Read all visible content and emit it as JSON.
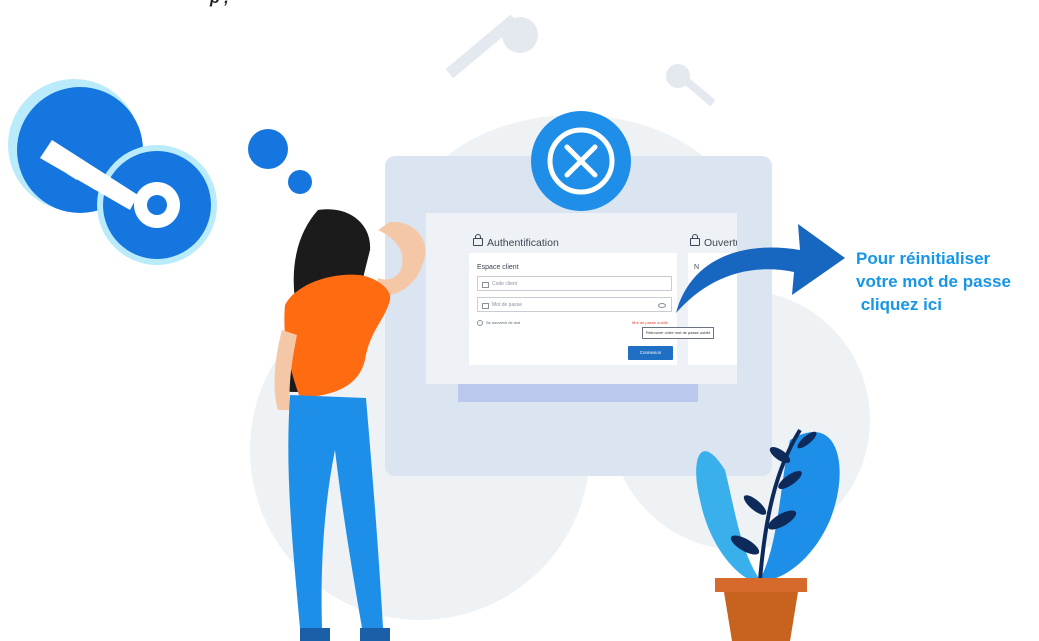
{
  "top_text": "p ,",
  "login": {
    "title": "Authentification",
    "right_title": "Ouvertu",
    "right_subtitle": "N",
    "section_label": "Espace client",
    "client_code_placeholder": "Code client",
    "password_placeholder": "Mot de passe",
    "remember_label": "Se souvenir de moi",
    "forgot_label": "Mot de passe oublié",
    "tooltip": "Retrouver votre mot de passe oublié",
    "connect_button": "Connexion"
  },
  "caption": {
    "line1": "Pour réinitialiser",
    "line2": "votre mot de passe",
    "line3": " cliquez ici"
  },
  "colors": {
    "brand_blue": "#1796e8",
    "arrow_blue": "#1f6fc4",
    "error_red": "#e2473b",
    "shirt_orange": "#ff6b10",
    "pants_blue": "#1e8fe8"
  }
}
